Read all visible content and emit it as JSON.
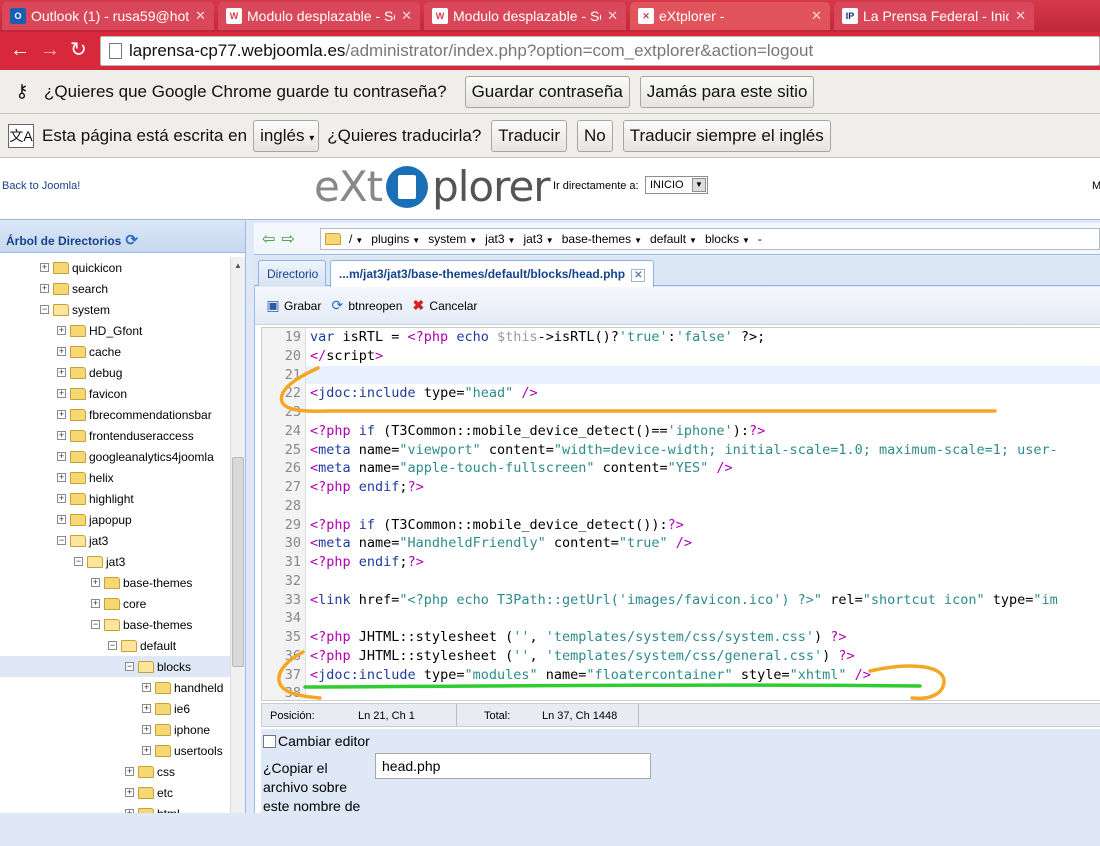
{
  "browser": {
    "tabs": [
      {
        "title": "Outlook (1) - rusa59@hot",
        "icon": "outlook-icon",
        "icon_text": "O",
        "icon_color": "#1a5fb4",
        "active": false
      },
      {
        "title": "Modulo desplazable - Ser",
        "icon": "joomla-icon",
        "icon_text": "W",
        "icon_color": "#ffffff",
        "active": false
      },
      {
        "title": "Modulo desplazable - Ser",
        "icon": "joomla-icon",
        "icon_text": "W",
        "icon_color": "#ffffff",
        "active": false
      },
      {
        "title": "eXtplorer -",
        "icon": "joomla-icon",
        "icon_text": "✕",
        "icon_color": "#ffffff",
        "active": true
      },
      {
        "title": "La Prensa Federal - Inicio",
        "icon": "lp-icon",
        "icon_text": "IP",
        "icon_color": "#ffffff",
        "active": false
      }
    ],
    "url_host": "laprensa-cp77.webjoomla.es",
    "url_path": "/administrator/index.php?option=com_extplorer&action=logout",
    "accent": "#d8283c"
  },
  "password_bar": {
    "message": "¿Quieres que Google Chrome guarde tu contraseña?",
    "save_label": "Guardar contraseña",
    "never_label": "Jamás para este sitio"
  },
  "translate_bar": {
    "message_before": "Esta página está escrita en",
    "language": "inglés",
    "question": "¿Quieres traducirla?",
    "translate_label": "Traducir",
    "no_label": "No",
    "always_label": "Traducir siempre el inglés"
  },
  "header": {
    "back_link": "Back to Joomla!",
    "logo_left": "eXt",
    "logo_right": "plorer",
    "goto_label": "Ir directamente a:",
    "goto_value": "INICIO",
    "right_letter": "M"
  },
  "tree": {
    "title": "Árbol de Directorios",
    "nodes": [
      {
        "label": "quickicon",
        "indent": 0,
        "exp": "+",
        "open": false
      },
      {
        "label": "search",
        "indent": 0,
        "exp": "+",
        "open": false
      },
      {
        "label": "system",
        "indent": 0,
        "exp": "−",
        "open": true
      },
      {
        "label": "HD_Gfont",
        "indent": 1,
        "exp": "+",
        "open": false
      },
      {
        "label": "cache",
        "indent": 1,
        "exp": "+",
        "open": false
      },
      {
        "label": "debug",
        "indent": 1,
        "exp": "+",
        "open": false
      },
      {
        "label": "favicon",
        "indent": 1,
        "exp": "+",
        "open": false
      },
      {
        "label": "fbrecommendationsbar",
        "indent": 1,
        "exp": "+",
        "open": false
      },
      {
        "label": "frontenduseraccess",
        "indent": 1,
        "exp": "+",
        "open": false
      },
      {
        "label": "googleanalytics4joomla",
        "indent": 1,
        "exp": "+",
        "open": false
      },
      {
        "label": "helix",
        "indent": 1,
        "exp": "+",
        "open": false
      },
      {
        "label": "highlight",
        "indent": 1,
        "exp": "+",
        "open": false
      },
      {
        "label": "japopup",
        "indent": 1,
        "exp": "+",
        "open": false
      },
      {
        "label": "jat3",
        "indent": 1,
        "exp": "−",
        "open": true
      },
      {
        "label": "jat3",
        "indent": 2,
        "exp": "−",
        "open": true
      },
      {
        "label": "base-themes",
        "indent": 3,
        "exp": "+",
        "open": false
      },
      {
        "label": "core",
        "indent": 3,
        "exp": "+",
        "open": false
      },
      {
        "label": "base-themes",
        "indent": 3,
        "exp": "−",
        "open": true
      },
      {
        "label": "default",
        "indent": 4,
        "exp": "−",
        "open": true
      },
      {
        "label": "blocks",
        "indent": 5,
        "exp": "−",
        "open": true,
        "selected": true
      },
      {
        "label": "handheld",
        "indent": 6,
        "exp": "+",
        "open": false
      },
      {
        "label": "ie6",
        "indent": 6,
        "exp": "+",
        "open": false
      },
      {
        "label": "iphone",
        "indent": 6,
        "exp": "+",
        "open": false
      },
      {
        "label": "usertools",
        "indent": 6,
        "exp": "+",
        "open": false
      },
      {
        "label": "css",
        "indent": 5,
        "exp": "+",
        "open": false
      },
      {
        "label": "etc",
        "indent": 5,
        "exp": "+",
        "open": false
      },
      {
        "label": "html",
        "indent": 5,
        "exp": "+",
        "open": false
      }
    ]
  },
  "breadcrumbs": [
    "/",
    "plugins",
    "system",
    "jat3",
    "jat3",
    "base-themes",
    "default",
    "blocks",
    "-"
  ],
  "tabs": {
    "directory": "Directorio",
    "file": "...m/jat3/jat3/base-themes/default/blocks/head.php"
  },
  "editor_toolbar": {
    "save": "Grabar",
    "reopen": "btnreopen",
    "cancel": "Cancelar"
  },
  "code": [
    {
      "n": "19",
      "segs": [
        [
          "k",
          "var "
        ],
        [
          "t",
          "isRTL = "
        ],
        [
          "p",
          "<?php "
        ],
        [
          "k",
          "echo "
        ],
        [
          "v",
          "$this"
        ],
        [
          "t",
          "->isRTL()?"
        ],
        [
          "s",
          "'true'"
        ],
        [
          "t",
          ":"
        ],
        [
          "s",
          "'false'"
        ],
        [
          "t",
          " ?>;"
        ]
      ]
    },
    {
      "n": "20",
      "segs": [
        [
          "p",
          "</"
        ],
        [
          "t",
          "script"
        ],
        [
          "p",
          ">"
        ]
      ]
    },
    {
      "n": "21",
      "segs": [],
      "hl": true
    },
    {
      "n": "22",
      "segs": [
        [
          "p",
          "<"
        ],
        [
          "k",
          "jdoc:include "
        ],
        [
          "t",
          "type="
        ],
        [
          "s",
          "\"head\""
        ],
        [
          "p",
          " />"
        ]
      ]
    },
    {
      "n": "23",
      "segs": []
    },
    {
      "n": "24",
      "segs": [
        [
          "p",
          "<?php "
        ],
        [
          "k",
          "if "
        ],
        [
          "t",
          "(T3Common::mobile_device_detect()=="
        ],
        [
          "s",
          "'iphone'"
        ],
        [
          "t",
          "):"
        ],
        [
          "p",
          "?>"
        ]
      ]
    },
    {
      "n": "25",
      "segs": [
        [
          "p",
          "<"
        ],
        [
          "k",
          "meta "
        ],
        [
          "t",
          "name="
        ],
        [
          "s",
          "\"viewport\""
        ],
        [
          "t",
          " content="
        ],
        [
          "s",
          "\"width=device-width; initial-scale=1.0; maximum-scale=1; user-"
        ]
      ]
    },
    {
      "n": "26",
      "segs": [
        [
          "p",
          "<"
        ],
        [
          "k",
          "meta "
        ],
        [
          "t",
          "name="
        ],
        [
          "s",
          "\"apple-touch-fullscreen\""
        ],
        [
          "t",
          " content="
        ],
        [
          "s",
          "\"YES\""
        ],
        [
          "p",
          " />"
        ]
      ]
    },
    {
      "n": "27",
      "segs": [
        [
          "p",
          "<?php "
        ],
        [
          "k",
          "endif"
        ],
        [
          "t",
          ";"
        ],
        [
          "p",
          "?>"
        ]
      ]
    },
    {
      "n": "28",
      "segs": []
    },
    {
      "n": "29",
      "segs": [
        [
          "p",
          "<?php "
        ],
        [
          "k",
          "if "
        ],
        [
          "t",
          "(T3Common::mobile_device_detect()):"
        ],
        [
          "p",
          "?>"
        ]
      ]
    },
    {
      "n": "30",
      "segs": [
        [
          "p",
          "<"
        ],
        [
          "k",
          "meta "
        ],
        [
          "t",
          "name="
        ],
        [
          "s",
          "\"HandheldFriendly\""
        ],
        [
          "t",
          " content="
        ],
        [
          "s",
          "\"true\""
        ],
        [
          "p",
          " />"
        ]
      ]
    },
    {
      "n": "31",
      "segs": [
        [
          "p",
          "<?php "
        ],
        [
          "k",
          "endif"
        ],
        [
          "t",
          ";"
        ],
        [
          "p",
          "?>"
        ]
      ]
    },
    {
      "n": "32",
      "segs": []
    },
    {
      "n": "33",
      "segs": [
        [
          "p",
          "<"
        ],
        [
          "k",
          "link "
        ],
        [
          "t",
          "href="
        ],
        [
          "s",
          "\"<?php echo T3Path::getUrl('images/favicon.ico') ?>\""
        ],
        [
          "t",
          " rel="
        ],
        [
          "s",
          "\"shortcut icon\""
        ],
        [
          "t",
          " type="
        ],
        [
          "s",
          "\"im"
        ]
      ]
    },
    {
      "n": "34",
      "segs": []
    },
    {
      "n": "35",
      "segs": [
        [
          "p",
          "<?php "
        ],
        [
          "t",
          "JHTML::stylesheet ("
        ],
        [
          "s",
          "''"
        ],
        [
          "t",
          ", "
        ],
        [
          "s",
          "'templates/system/css/system.css'"
        ],
        [
          "t",
          ") "
        ],
        [
          "p",
          "?>"
        ]
      ]
    },
    {
      "n": "36",
      "segs": [
        [
          "p",
          "<?php "
        ],
        [
          "t",
          "JHTML::stylesheet ("
        ],
        [
          "s",
          "''"
        ],
        [
          "t",
          ", "
        ],
        [
          "s",
          "'templates/system/css/general.css'"
        ],
        [
          "t",
          ") "
        ],
        [
          "p",
          "?>"
        ]
      ]
    },
    {
      "n": "37",
      "segs": [
        [
          "p",
          "<"
        ],
        [
          "k",
          "jdoc:include "
        ],
        [
          "t",
          "type="
        ],
        [
          "s",
          "\"modules\""
        ],
        [
          "t",
          " name="
        ],
        [
          "s",
          "\"floatercontainer\""
        ],
        [
          "t",
          " style="
        ],
        [
          "s",
          "\"xhtml\""
        ],
        [
          "p",
          " />"
        ]
      ]
    },
    {
      "n": "38",
      "segs": []
    }
  ],
  "status": {
    "position_label": "Posición:",
    "position_value": "Ln 21, Ch 1",
    "total_label": "Total:",
    "total_value": "Ln 37, Ch 1448"
  },
  "form": {
    "toggle_editor": "Cambiar editor",
    "copy_label": "¿Copiar el archivo sobre este nombre de",
    "copy_value": "head.php"
  },
  "annotation_colors": {
    "orange": "#f5a623",
    "green": "#2ecc2e"
  }
}
